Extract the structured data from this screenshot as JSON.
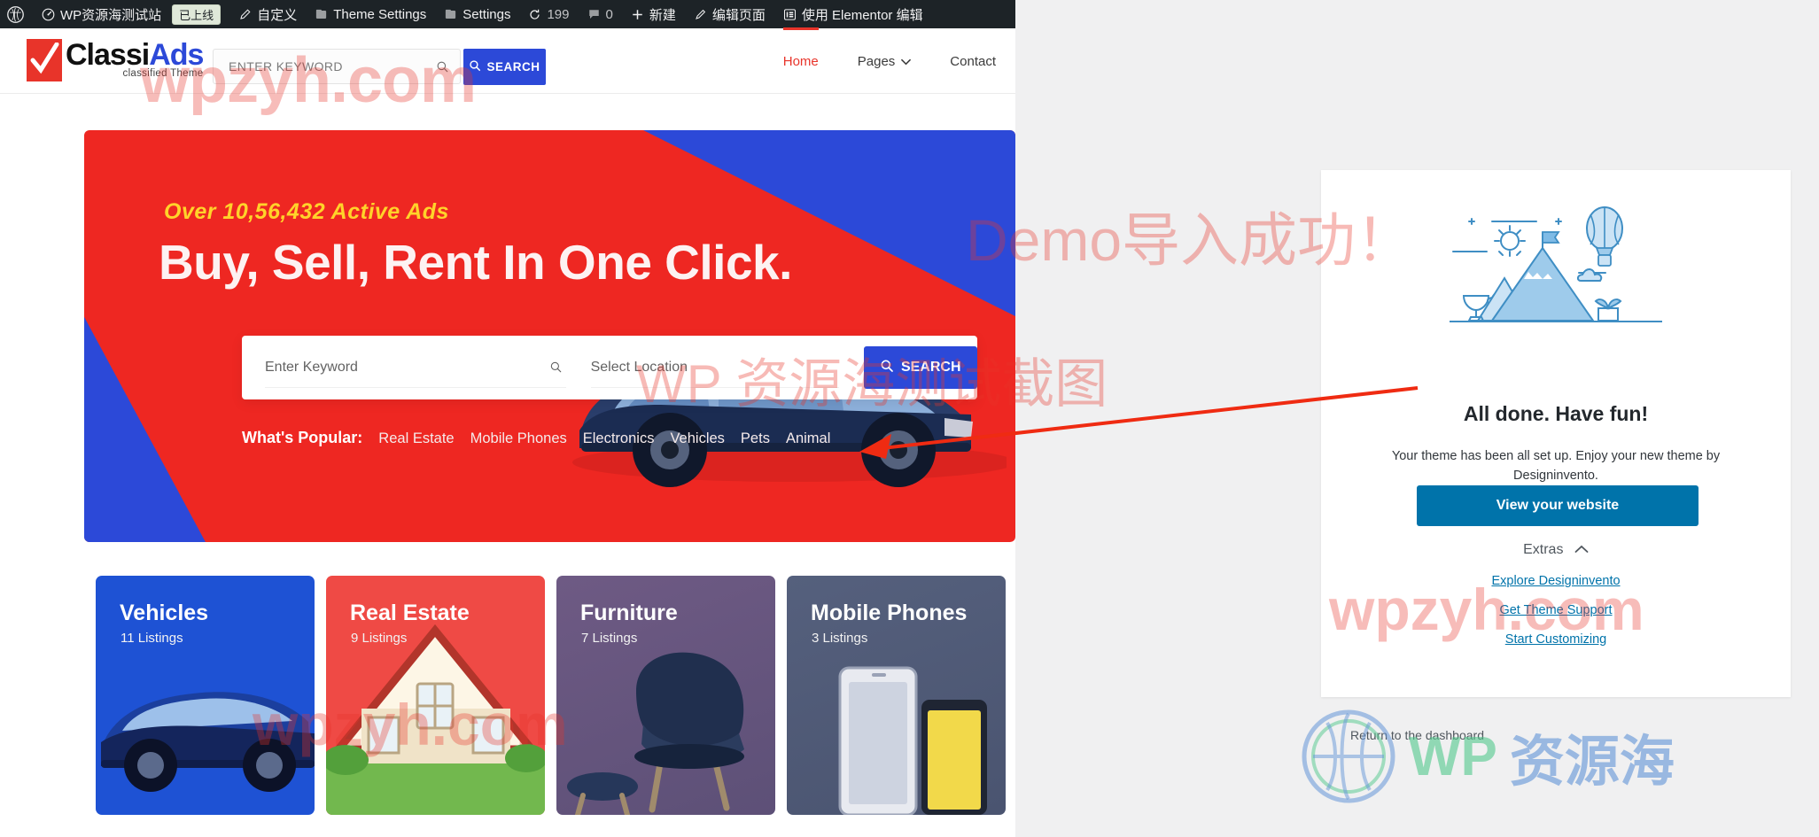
{
  "adminbar": {
    "items": [
      {
        "icon": "wordpress-logo-icon",
        "label": ""
      },
      {
        "icon": "dashboard-icon",
        "label": "WP资源海测试站",
        "badge": "已上线"
      },
      {
        "icon": "pencil-icon",
        "label": "自定义"
      },
      {
        "icon": "paintbrush-icon",
        "label": "Theme Settings"
      },
      {
        "icon": "gear-icon",
        "label": "Settings"
      },
      {
        "icon": "update-icon",
        "label": "199"
      },
      {
        "icon": "comment-icon",
        "label": "0"
      },
      {
        "icon": "plus-icon",
        "label": "新建"
      },
      {
        "icon": "edit-icon",
        "label": "编辑页面"
      },
      {
        "icon": "elementor-icon",
        "label": "使用 Elementor 编辑"
      }
    ]
  },
  "header": {
    "logo": {
      "primary": "Classi",
      "secondary": "Ads",
      "tagline": "classified Theme"
    },
    "search": {
      "placeholder": "ENTER KEYWORD",
      "value": "",
      "button_label": "SEARCH",
      "icon": "search-icon"
    },
    "nav": [
      {
        "label": "Home",
        "active": true,
        "has_caret": false
      },
      {
        "label": "Pages",
        "active": false,
        "has_caret": true
      },
      {
        "label": "Contact",
        "active": false,
        "has_caret": false
      }
    ]
  },
  "hero": {
    "subtitle": "Over 10,56,432 Active Ads",
    "title": "Buy, Sell, Rent In One Click.",
    "search": {
      "keyword_placeholder": "Enter Keyword",
      "keyword_value": "",
      "location_placeholder": "Select Location",
      "location_value": "",
      "button_label": "SEARCH",
      "icon": "search-icon"
    },
    "popular_label": "What's Popular:",
    "popular_items": [
      "Real Estate",
      "Mobile Phones",
      "Electronics",
      "Vehicles",
      "Pets",
      "Animal"
    ],
    "colors": {
      "red": "#ee2722",
      "blue": "#2c49d8",
      "yellow": "#ffd32a"
    }
  },
  "categories": [
    {
      "title": "Vehicles",
      "listings": "11 Listings",
      "art": "car-illustration",
      "color": "#1e52d4"
    },
    {
      "title": "Real Estate",
      "listings": "9 Listings",
      "art": "house-illustration",
      "color": "#ef4a45"
    },
    {
      "title": "Furniture",
      "listings": "7 Listings",
      "art": "chair-illustration",
      "color": "#6e5a84"
    },
    {
      "title": "Mobile Phones",
      "listings": "3 Listings",
      "art": "phones-illustration",
      "color": "#55607d"
    }
  ],
  "import_dialog": {
    "illustration": "mountain-balloon-illustration",
    "title": "All done. Have fun!",
    "description": "Your theme has been all set up. Enjoy your new theme by Designinvento.",
    "primary_button": "View your website",
    "extras_label": "Extras",
    "extras_caret": "chevron-up-icon",
    "extras_links": [
      "Explore Designinvento",
      "Get Theme Support",
      "Start Customizing"
    ],
    "return_link": "Return to the dashboard",
    "accent": "#0073aa"
  },
  "watermarks": {
    "wm1": "wpzyh.com",
    "wm2": "Demo导入成功！",
    "wm3": "WP 资源海测试截图",
    "wm4": "wpzyh.com",
    "wm5": "wpzyh.com",
    "logo_left": "WP",
    "logo_right": "资源海"
  }
}
